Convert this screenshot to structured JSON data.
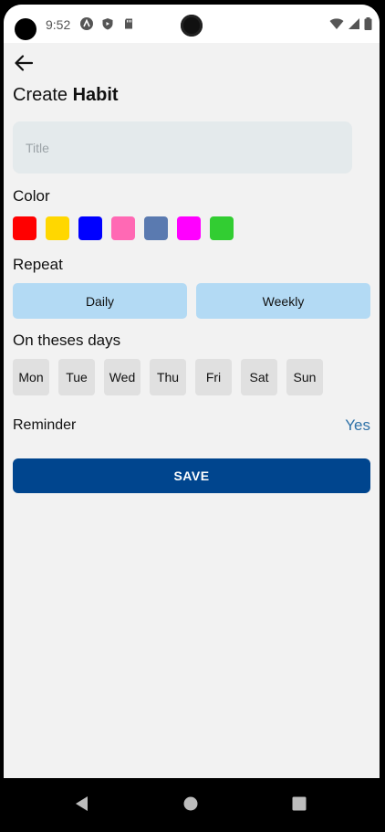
{
  "status_bar": {
    "time": "9:52"
  },
  "header": {
    "title_prefix": "Create ",
    "title_bold": "Habit"
  },
  "title_field": {
    "placeholder": "Title",
    "value": ""
  },
  "color_section": {
    "label": "Color",
    "swatches": [
      "#ff0000",
      "#ffd700",
      "#0000ff",
      "#ff69b4",
      "#5a7ab0",
      "#ff00ff",
      "#32cd32"
    ]
  },
  "repeat_section": {
    "label": "Repeat",
    "options": [
      "Daily",
      "Weekly"
    ]
  },
  "days_section": {
    "label": "On theses days",
    "days": [
      "Mon",
      "Tue",
      "Wed",
      "Thu",
      "Fri",
      "Sat",
      "Sun"
    ]
  },
  "reminder": {
    "label": "Reminder",
    "value": "Yes"
  },
  "save_label": "SAVE",
  "colors": {
    "accent": "#00458e",
    "repeat_bg": "#b3daf4",
    "reminder_value": "#2f72a8"
  }
}
